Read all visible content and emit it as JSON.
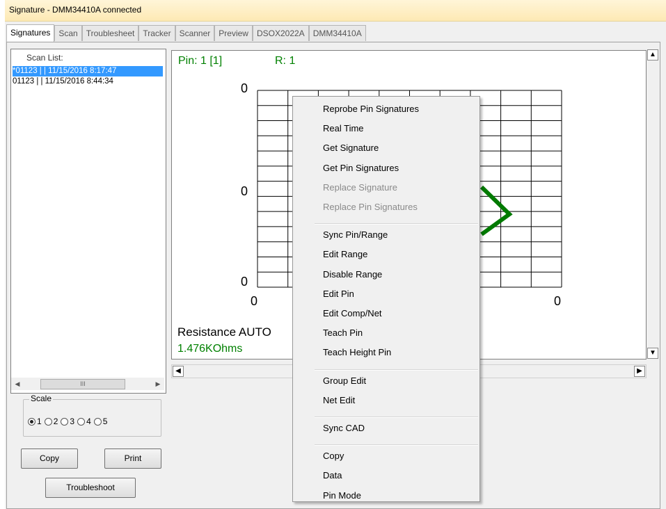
{
  "window": {
    "title": "Signature - DMM34410A connected"
  },
  "tabs": [
    "Signatures",
    "Scan",
    "Troublesheet",
    "Tracker",
    "Scanner",
    "Preview",
    "DSOX2022A",
    "DMM34410A"
  ],
  "scan_list": {
    "header": "Scan List:",
    "items": [
      "*01123 |  | 11/15/2016 8:17:47",
      "01123 |  | 11/15/2016 8:44:34"
    ],
    "scroll_thumb": "III"
  },
  "scale": {
    "legend": "Scale",
    "options": [
      "1",
      "2",
      "3",
      "4",
      "5"
    ],
    "selected": "1"
  },
  "buttons": {
    "copy": "Copy",
    "print": "Print",
    "troubleshoot": "Troubleshoot"
  },
  "plot": {
    "pin": "Pin: 1 [1]",
    "range": "R: 1",
    "y_top": "0",
    "y_mid": "0",
    "y_bottom": "0",
    "x_left": "0",
    "x_right": "0",
    "mode": "Resistance  AUTO",
    "value": "1.476KOhms",
    "colors": {
      "green": "#008000",
      "trace": "#007a00"
    }
  },
  "context_menu": {
    "groups": [
      [
        {
          "label": "Reprobe Pin Signatures",
          "enabled": true
        },
        {
          "label": "Real Time",
          "enabled": true
        },
        {
          "label": "Get Signature",
          "enabled": true
        },
        {
          "label": "Get Pin Signatures",
          "enabled": true
        },
        {
          "label": "Replace Signature",
          "enabled": false
        },
        {
          "label": "Replace Pin Signatures",
          "enabled": false
        }
      ],
      [
        {
          "label": "Sync Pin/Range",
          "enabled": true
        },
        {
          "label": "Edit Range",
          "enabled": true
        },
        {
          "label": "Disable Range",
          "enabled": true
        },
        {
          "label": "Edit Pin",
          "enabled": true
        },
        {
          "label": "Edit Comp/Net",
          "enabled": true
        },
        {
          "label": "Teach Pin",
          "enabled": true
        },
        {
          "label": "Teach Height Pin",
          "enabled": true
        }
      ],
      [
        {
          "label": "Group Edit",
          "enabled": true
        },
        {
          "label": "Net Edit",
          "enabled": true
        }
      ],
      [
        {
          "label": "Sync CAD",
          "enabled": true
        }
      ],
      [
        {
          "label": "Copy",
          "enabled": true
        },
        {
          "label": "Data",
          "enabled": true
        },
        {
          "label": "Pin Mode",
          "enabled": true
        }
      ]
    ]
  }
}
